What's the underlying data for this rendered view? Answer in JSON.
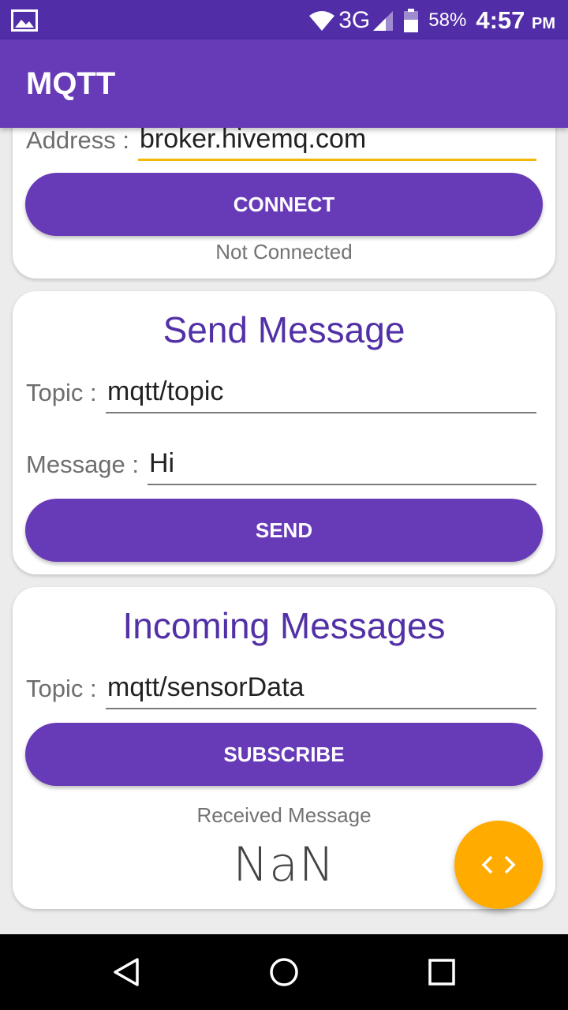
{
  "status_bar": {
    "network": "3G",
    "battery": "58%",
    "time": "4:57",
    "ampm": "PM",
    "icons": [
      "gallery-icon",
      "wifi-icon",
      "signal-icon",
      "battery-icon"
    ]
  },
  "app_bar": {
    "title": "MQTT"
  },
  "connect_card": {
    "address_label": "Address :",
    "address_value": "broker.hivemq.com",
    "connect_button": "CONNECT",
    "status": "Not Connected"
  },
  "send_card": {
    "title": "Send Message",
    "topic_label": "Topic :",
    "topic_value": "mqtt/topic",
    "message_label": "Message :",
    "message_value": "Hi",
    "send_button": "SEND"
  },
  "incoming_card": {
    "title": "Incoming Messages",
    "topic_label": "Topic :",
    "topic_value": "mqtt/sensorData",
    "subscribe_button": "SUBSCRIBE",
    "received_label": "Received Message",
    "received_value": "NaN"
  },
  "fab": {
    "icon": "code-icon"
  },
  "nav": {
    "icons": [
      "back-icon",
      "home-icon",
      "recents-icon"
    ]
  },
  "colors": {
    "primary": "#673ab7",
    "primary_dark": "#512da8",
    "accent": "#ffab00",
    "focus_underline": "#f2b90d"
  }
}
